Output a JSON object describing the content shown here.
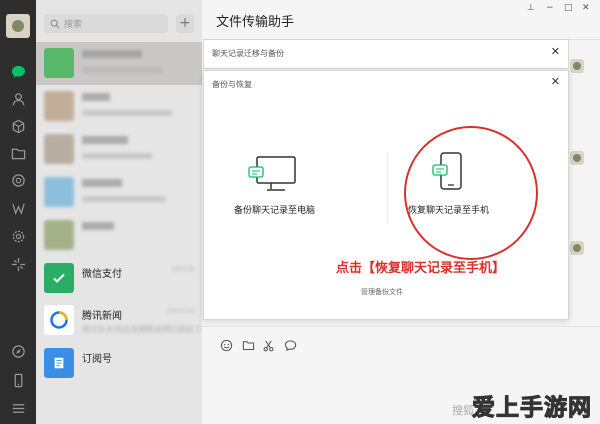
{
  "sidebar_icons": [
    "chat-icon",
    "contacts-icon",
    "favorites-icon",
    "files-icon",
    "moments-icon",
    "mini-program-icon",
    "settings-gear-icon",
    "sparkle-icon",
    "compass-icon",
    "phone-icon",
    "menu-icon"
  ],
  "search": {
    "placeholder": "搜索",
    "add_label": "+"
  },
  "chat_list": [
    {
      "name": "",
      "sub": "",
      "time": "",
      "blurred": true
    },
    {
      "name": "",
      "sub": "",
      "time": "",
      "blurred": true
    },
    {
      "name": "",
      "sub": "",
      "time": "",
      "blurred": true
    },
    {
      "name": "",
      "sub": "",
      "time": "",
      "blurred": true
    },
    {
      "name": "",
      "sub": "",
      "time": "",
      "blurred": true
    },
    {
      "name": "微信支付",
      "sub": "",
      "time": "24/5/9",
      "blurred": false
    },
    {
      "name": "腾讯新闻",
      "sub": "荷兰队长向达连拥抱说明已经好了",
      "time": "24/7/10",
      "blurred": false
    },
    {
      "name": "订阅号",
      "sub": "",
      "time": "",
      "blurred": false
    }
  ],
  "chat": {
    "title": "文件传输助手",
    "window_controls": {
      "pin": "⊥",
      "minimize": "−",
      "maximize": "□",
      "close": "✕"
    }
  },
  "dialog_migrate": {
    "title": "聊天记录迁移与备份",
    "close": "✕"
  },
  "dialog_backup": {
    "title": "备份与恢复",
    "close": "✕",
    "option_pc": "备份聊天记录至电脑",
    "option_phone": "恢复聊天记录至手机",
    "callout": "点击【恢复聊天记录至手机】",
    "manage_link": "管理备份文件"
  },
  "input_tools": [
    "emoji-icon",
    "folder-icon",
    "scissors-icon",
    "chat-bubble-icon"
  ],
  "watermark": {
    "search": "搜狐",
    "logo": "爱上手游网"
  },
  "colors": {
    "accent_green": "#07c160",
    "highlight_red": "#d9312b",
    "sidebar": "#2e2e2e"
  }
}
